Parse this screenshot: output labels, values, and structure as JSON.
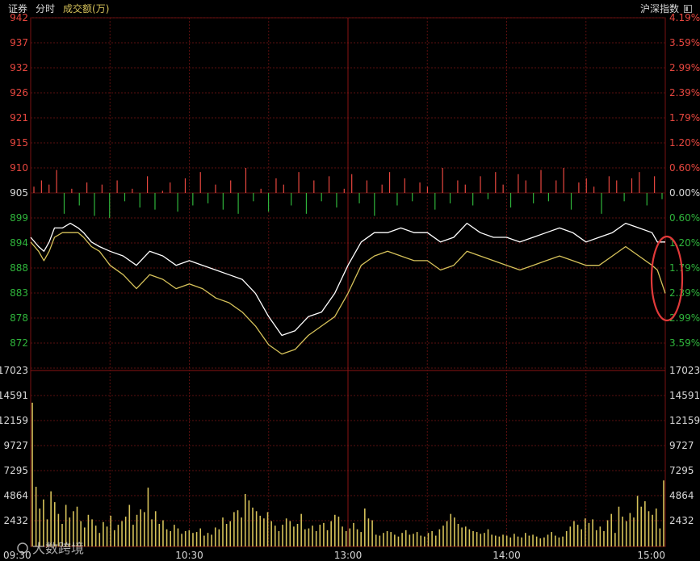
{
  "header": {
    "tab_stock": "证券",
    "tab_intraday": "分时",
    "tab_volume": "成交额(万)",
    "index_name": "沪深指数"
  },
  "watermark": "大数跨境",
  "colors": {
    "up": "#e8473f",
    "down": "#2fb43b",
    "grid": "#5a0f0f",
    "price_line": "#ffffff",
    "avg_line": "#d6c25a",
    "volume_bar": "#d6c25a",
    "annotation": "#e03a3a"
  },
  "chart_data": [
    {
      "type": "line",
      "description_key": "price",
      "ylim": [
        867,
        942
      ],
      "base": 905,
      "left_ticks": [
        "942",
        "937",
        "932",
        "926",
        "921",
        "915",
        "910",
        "905",
        "899",
        "894",
        "888",
        "883",
        "878",
        "872"
      ],
      "right_ticks": [
        "4.19%",
        "3.59%",
        "2.99%",
        "2.39%",
        "1.79%",
        "1.20%",
        "0.60%",
        "0.00%",
        "0.60%",
        "1.20%",
        "1.79%",
        "2.39%",
        "2.99%",
        "3.59%"
      ],
      "x_ticks": [
        "09:30",
        "10:30",
        "13:00",
        "14:00",
        "15:00"
      ],
      "series": [
        {
          "x": [
            0,
            3,
            5,
            7,
            9,
            12,
            15,
            18,
            20,
            23,
            26,
            30,
            35,
            40,
            45,
            50,
            55,
            60,
            65,
            70,
            75,
            80,
            85,
            90,
            95,
            100,
            105,
            110,
            115,
            120,
            125,
            130,
            135,
            140,
            145,
            150,
            155,
            160,
            165,
            170,
            175,
            180,
            185,
            190,
            195,
            200,
            205,
            210,
            215,
            220,
            225,
            230,
            235,
            237,
            240
          ],
          "values": [
            895,
            893,
            892,
            894,
            897,
            897,
            898,
            897,
            896,
            894,
            893,
            892,
            891,
            889,
            892,
            891,
            889,
            890,
            889,
            888,
            887,
            886,
            883,
            878,
            874,
            875,
            878,
            879,
            883,
            889,
            894,
            896,
            896,
            897,
            896,
            896,
            894,
            895,
            898,
            896,
            895,
            895,
            894,
            895,
            896,
            897,
            896,
            894,
            895,
            896,
            898,
            897,
            896,
            894,
            894
          ]
        },
        {
          "x": [
            0,
            3,
            5,
            7,
            9,
            12,
            15,
            18,
            20,
            23,
            26,
            30,
            35,
            40,
            45,
            50,
            55,
            60,
            65,
            70,
            75,
            80,
            85,
            90,
            95,
            100,
            105,
            110,
            115,
            120,
            125,
            130,
            135,
            140,
            145,
            150,
            155,
            160,
            165,
            170,
            175,
            180,
            185,
            190,
            195,
            200,
            205,
            210,
            215,
            220,
            225,
            230,
            235,
            237,
            240
          ],
          "values": [
            894,
            892,
            890,
            892,
            895,
            896,
            896,
            896,
            895,
            893,
            892,
            889,
            887,
            884,
            887,
            886,
            884,
            885,
            884,
            882,
            881,
            879,
            876,
            872,
            870,
            871,
            874,
            876,
            878,
            883,
            889,
            891,
            892,
            891,
            890,
            890,
            888,
            889,
            892,
            891,
            890,
            889,
            888,
            889,
            890,
            891,
            890,
            889,
            889,
            891,
            893,
            891,
            889,
            888,
            883
          ]
        }
      ]
    },
    {
      "type": "bar",
      "description_key": "net_order_bars",
      "units": "percent",
      "values": [
        0.15,
        0.3,
        0.2,
        0.55,
        -0.5,
        0.1,
        -0.3,
        0.25,
        -0.55,
        0.2,
        -0.6,
        0.3,
        -0.2,
        0.1,
        -0.35,
        0.4,
        -0.4,
        0.05,
        0.25,
        -0.45,
        0.35,
        -0.3,
        0.5,
        -0.25,
        0.2,
        -0.4,
        0.3,
        -0.5,
        0.6,
        -0.2,
        0.1,
        -0.45,
        0.35,
        0.2,
        -0.3,
        0.5,
        -0.5,
        0.3,
        -0.2,
        0.4,
        -0.35,
        0.1,
        0.45,
        -0.25,
        0.3,
        -0.55,
        0.2,
        0.5,
        -0.3,
        0.35,
        -0.2,
        0.25,
        0.15,
        -0.4,
        0.6,
        -0.25,
        0.3,
        0.2,
        -0.3,
        0.4,
        -0.15,
        0.5,
        0.2,
        -0.35,
        0.45,
        0.3,
        -0.25,
        0.55,
        -0.2,
        0.3,
        0.6,
        -0.4,
        0.25,
        0.35,
        0.15,
        -0.5,
        0.4,
        0.3,
        -0.2,
        0.35,
        0.5,
        -0.3,
        0.4,
        -0.15
      ]
    },
    {
      "type": "bar",
      "description_key": "volume",
      "ylim": [
        0,
        19455
      ],
      "y_ticks": [
        "17023",
        "14591",
        "12159",
        "9727",
        "7295",
        "4864",
        "2432"
      ],
      "values": [
        15900,
        6600,
        4200,
        5200,
        3000,
        6100,
        4900,
        3600,
        2500,
        4600,
        3200,
        3900,
        4400,
        2800,
        2100,
        3500,
        3000,
        2300,
        1500,
        2700,
        2200,
        3400,
        1800,
        2400,
        2800,
        3300,
        4600,
        2400,
        3500,
        4100,
        3800,
        6500,
        3000,
        3900,
        2500,
        2900,
        1900,
        1700,
        2400,
        2000,
        1400,
        1700,
        1800,
        1500,
        1600,
        2000,
        1200,
        1500,
        1300,
        2100,
        1900,
        3200,
        2500,
        2800,
        3800,
        4000,
        3200,
        5800,
        5100,
        4300,
        3900,
        3400,
        3100,
        3800,
        2800,
        2300,
        1700,
        2400,
        3100,
        2800,
        2200,
        2500,
        3600,
        1900,
        2000,
        2300,
        1700,
        2400,
        2600,
        1800,
        2800,
        3500,
        3300,
        2200,
        1700,
        2000,
        2600,
        1900,
        1600,
        4200,
        3100,
        2900,
        1300,
        1200,
        1500,
        1700,
        1600,
        1300,
        1100,
        1500,
        1800,
        1300,
        1400,
        1600,
        1200,
        1100,
        1500,
        1700,
        1200,
        1900,
        2300,
        2800,
        3600,
        3200,
        2500,
        2100,
        2200,
        1900,
        1700,
        1600,
        1400,
        1500,
        1900,
        1300,
        1200,
        1100,
        1300,
        1200,
        1000,
        1400,
        1100,
        1000,
        1500,
        1200,
        1300,
        1100,
        900,
        1000,
        1300,
        1600,
        1200,
        1000,
        1100,
        1700,
        2200,
        2800,
        2400,
        1900,
        3100,
        2600,
        3000,
        1800,
        2200,
        1700,
        2900,
        3600,
        1500,
        4400,
        3300,
        2800,
        3700,
        3200,
        5600,
        4400,
        5000,
        3900,
        3500,
        4200,
        2000,
        7300
      ]
    }
  ]
}
